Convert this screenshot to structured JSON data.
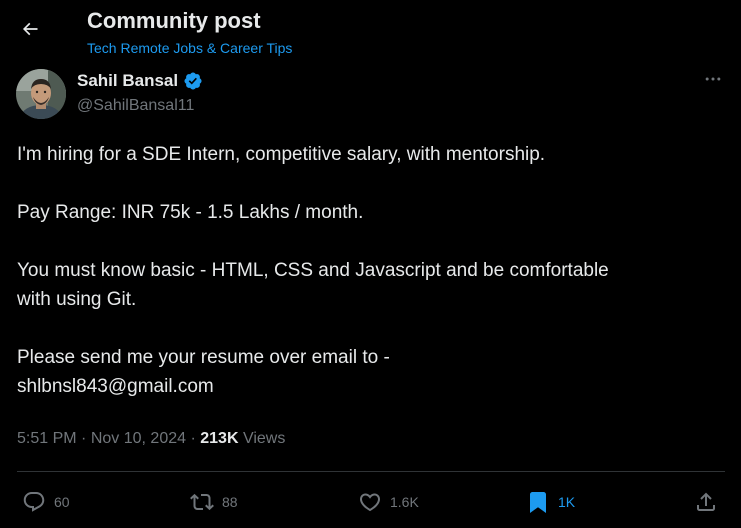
{
  "header": {
    "title": "Community post",
    "community_name": "Tech Remote Jobs & Career Tips"
  },
  "author": {
    "name": "Sahil Bansal",
    "handle": "@SahilBansal11",
    "verified": true
  },
  "post": {
    "lines": [
      "I'm hiring for a SDE Intern, competitive salary, with mentorship.",
      "Pay Range: INR 75k - 1.5 Lakhs / month.",
      "You must know basic - HTML, CSS and Javascript and be comfortable",
      "with using Git.",
      "Please send me your resume over email to -",
      "shlbnsl843@gmail.com"
    ]
  },
  "meta": {
    "time": "5:51 PM",
    "separator": "·",
    "date": "Nov 10, 2024",
    "views_count": "213K",
    "views_label": "Views"
  },
  "actions": {
    "replies": "60",
    "reposts": "88",
    "likes": "1.6K",
    "bookmarks": "1K"
  },
  "colors": {
    "background": "#000000",
    "text_primary": "#e7e9ea",
    "text_secondary": "#71767b",
    "accent": "#1d9bf0",
    "divider": "#2f3336"
  },
  "icons": [
    "back-arrow-icon",
    "verified-badge-icon",
    "more-icon",
    "reply-icon",
    "repost-icon",
    "like-icon",
    "bookmark-icon",
    "share-icon"
  ]
}
